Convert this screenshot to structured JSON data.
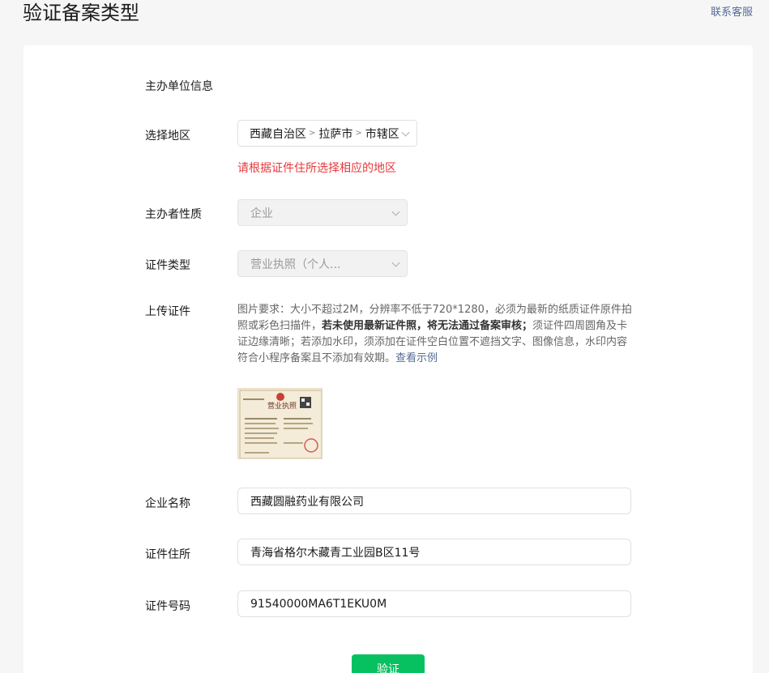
{
  "header": {
    "title": "验证备案类型",
    "support_link": "联系客服"
  },
  "form": {
    "section_title": "主办单位信息",
    "region": {
      "label": "选择地区",
      "province": "西藏自治区",
      "city": "拉萨市",
      "district": "市辖区",
      "hint": "请根据证件住所选择相应的地区"
    },
    "organizer_type": {
      "label": "主办者性质",
      "value": "企业"
    },
    "certificate_type": {
      "label": "证件类型",
      "value": "营业执照（个人..."
    },
    "upload": {
      "label": "上传证件",
      "desc_part1": "图片要求：大小不超过2M，分辨率不低于720*1280，必须为最新的纸质证件原件拍照或彩色扫描件，",
      "desc_bold": "若未使用最新证件照，将无法通过备案审核；",
      "desc_part2": "须证件四周圆角及卡证边缘清晰；若添加水印，须添加在证件空白位置不遮挡文字、图像信息，水印内容符合小程序备案且不添加有效期。",
      "example_link": "查看示例",
      "thumb_title": "营业执照"
    },
    "company_name": {
      "label": "企业名称",
      "value": "西藏圆融药业有限公司"
    },
    "certificate_address": {
      "label": "证件住所",
      "value": "青海省格尔木藏青工业园B区11号"
    },
    "certificate_number": {
      "label": "证件号码",
      "value": "91540000MA6T1EKU0M"
    },
    "submit_label": "验证"
  },
  "colors": {
    "primary": "#07c160",
    "link": "#576b95",
    "error": "#e4393c",
    "page_bg": "#f6f6f6"
  }
}
